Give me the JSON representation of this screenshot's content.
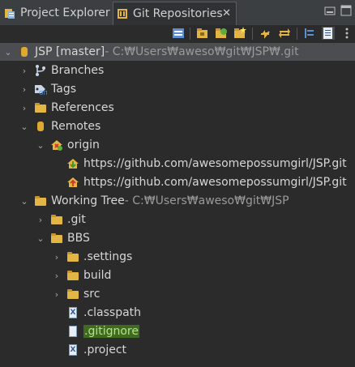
{
  "tabs": [
    {
      "label": "Project Explorer"
    },
    {
      "label": "Git Repositories",
      "close": "✕"
    }
  ],
  "tree": {
    "repo": {
      "label": "JSP [master]",
      "path": " - C:₩Users₩aweso₩git₩JSP₩.git"
    },
    "branches": "Branches",
    "tags": "Tags",
    "references": "References",
    "remotes": "Remotes",
    "origin": "origin",
    "fetch_url": "https://github.com/awesomepossumgirl/JSP.git",
    "push_url": "https://github.com/awesomepossumgirl/JSP.git",
    "working_tree": {
      "label": "Working Tree",
      "path": " - C:₩Users₩aweso₩git₩JSP"
    },
    "git_folder": ".git",
    "bbs": "BBS",
    "settings": ".settings",
    "build": "build",
    "src": "src",
    "classpath": ".classpath",
    "gitignore": ".gitignore",
    "project": ".project"
  },
  "icons": {
    "tab1": "project-explorer-icon",
    "tab2": "git-repositories-icon",
    "repo": "git-repository-icon",
    "branches": "branches-icon",
    "tags": "tags-icon",
    "remote": "remote-icon",
    "fetch": "fetch-icon",
    "push": "push-icon"
  },
  "colors": {
    "background": "#2b2b2b",
    "selection": "#4b4d50",
    "highlight": "#3f6b20",
    "folder": "#e3b544"
  }
}
